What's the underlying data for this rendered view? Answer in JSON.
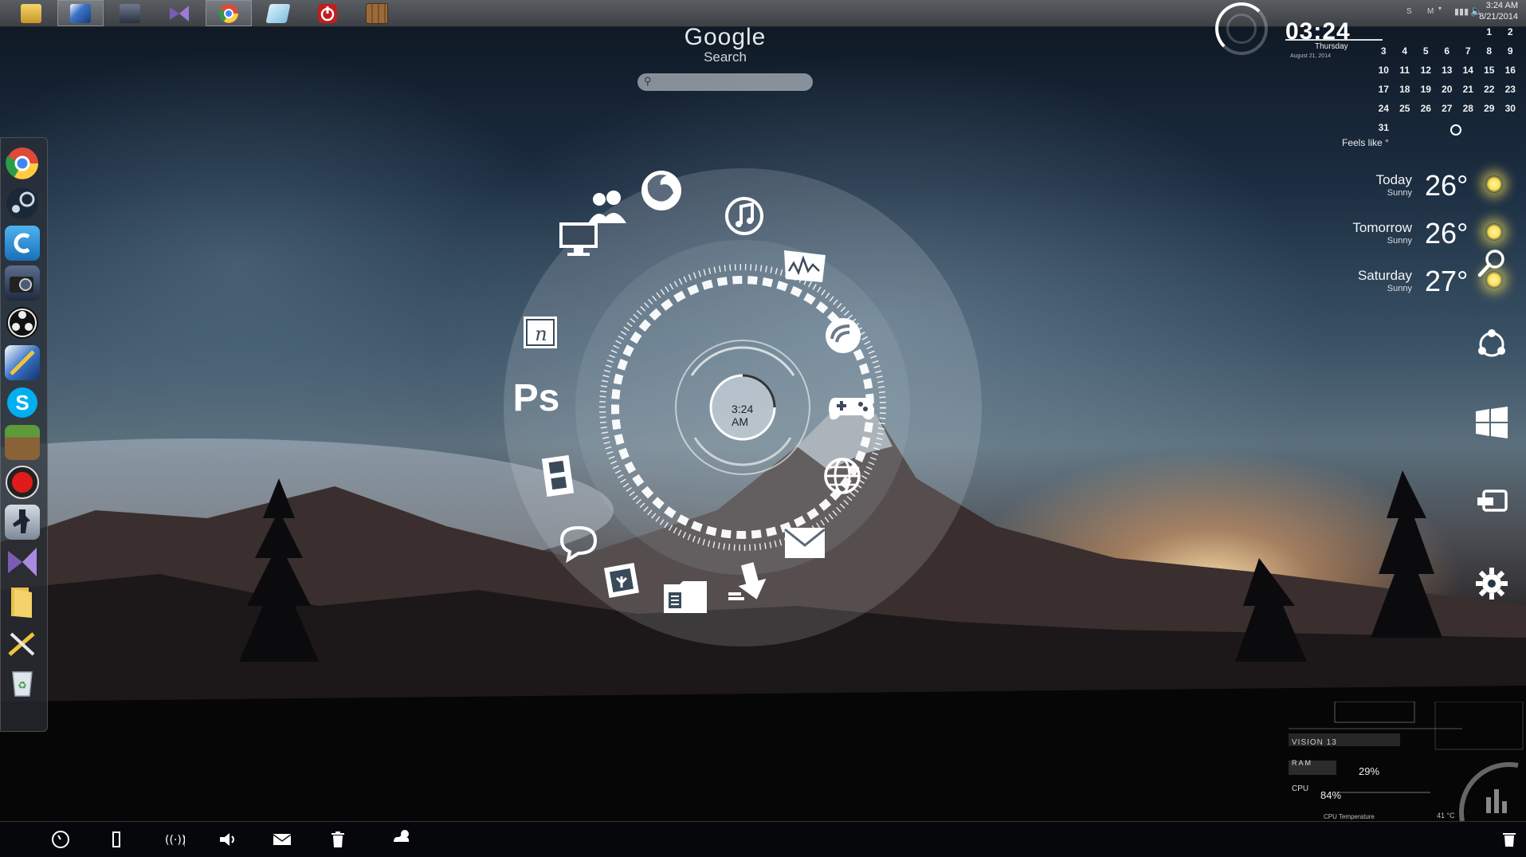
{
  "taskbar": {
    "apps": [
      {
        "name": "file-explorer",
        "color": "#e8c24a"
      },
      {
        "name": "sketch-app",
        "color": "#3a74c9"
      },
      {
        "name": "camera-app",
        "color": "#3a4b6a"
      },
      {
        "name": "visual-studio",
        "color": "#7b5bb5"
      },
      {
        "name": "chrome",
        "color": "#dd4b39"
      },
      {
        "name": "notes-app",
        "color": "#8ec8e8"
      },
      {
        "name": "shutdown-app",
        "color": "#c21d1d"
      },
      {
        "name": "minecraft-chest",
        "color": "#9a6b3a"
      }
    ],
    "tray": {
      "time": "3:24 AM",
      "date": "8/21/2014",
      "lang": "S",
      "input_icon": "M"
    }
  },
  "search": {
    "title": "Google",
    "subtitle": "Search",
    "placeholder": ""
  },
  "clock_widget": {
    "time": "03:24",
    "day": "Thursday",
    "date": "August 21, 2014"
  },
  "calendar": {
    "rows": [
      [
        "",
        "",
        "",
        "",
        "",
        "1",
        "2"
      ],
      [
        "3",
        "4",
        "5",
        "6",
        "7",
        "8",
        "9"
      ],
      [
        "10",
        "11",
        "12",
        "13",
        "14",
        "15",
        "16"
      ],
      [
        "17",
        "18",
        "19",
        "20",
        "21",
        "22",
        "23"
      ],
      [
        "24",
        "25",
        "26",
        "27",
        "28",
        "29",
        "30"
      ],
      [
        "31",
        "",
        "",
        "",
        "",
        "",
        ""
      ]
    ]
  },
  "weather": {
    "feels_like": "Feels like °",
    "forecast": [
      {
        "day": "Today",
        "condition": "Sunny",
        "temp": "26°"
      },
      {
        "day": "Tomorrow",
        "condition": "Sunny",
        "temp": "26°"
      },
      {
        "day": "Saturday",
        "condition": "Sunny",
        "temp": "27°"
      }
    ]
  },
  "launcher": {
    "center_time_line1": "3:24",
    "center_time_line2": "AM",
    "ps_label": "Ps",
    "icons": [
      "people",
      "firefox",
      "music",
      "monitor",
      "waveform",
      "notes",
      "torrent",
      "photoshop",
      "gamepad",
      "film",
      "globe",
      "chat",
      "mail",
      "photo",
      "folder",
      "download"
    ]
  },
  "dock": {
    "items": [
      "chrome",
      "steam",
      "ccleaner",
      "video-camera",
      "obs",
      "sketch",
      "skype",
      "minecraft",
      "record",
      "counter-strike",
      "visual-studio",
      "folder",
      "tools",
      "recycle-bin"
    ]
  },
  "charms": [
    "search",
    "share",
    "start",
    "devices",
    "settings"
  ],
  "sysmon": {
    "title": "VISION 13",
    "ram_label": "R A M",
    "ram_value": "29%",
    "cpu_label": "CPU",
    "cpu_value": "84%",
    "temp_label": "CPU Temperature",
    "temp_value": "41 °C"
  },
  "bottombar": {
    "items": [
      "clock",
      "battery",
      "wifi",
      "volume",
      "mail",
      "trash",
      "weather",
      "bin-right"
    ]
  },
  "colors": {
    "accent": "#ffffff",
    "sun": "#ffe050",
    "taskbar": "#4a4d52"
  }
}
